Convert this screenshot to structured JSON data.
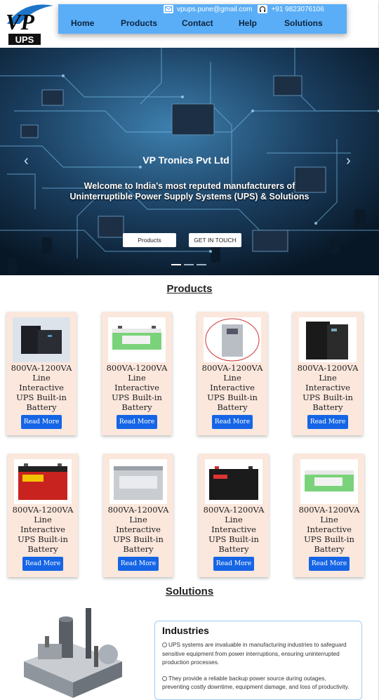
{
  "header": {
    "logo_text": "UPS",
    "email": "vpups.pune@gmail.com",
    "phone": "+91 9823076106",
    "nav": [
      "Home",
      "Products",
      "Contact",
      "Help",
      "Solutions"
    ]
  },
  "hero": {
    "title": "VP Tronics Pvt Ltd",
    "subtitle_line1": "Welcome to India's most reputed manufacturers of",
    "subtitle_line2": "Uninterruptible Power Supply Systems (UPS) & Solutions",
    "btn_products": "Products",
    "btn_contact": "GET IN TOUCH"
  },
  "products": {
    "title": "Products",
    "cards": [
      {
        "l1": "800VA-1200VA",
        "l2": "Line",
        "l3": "Interactive",
        "l4": "UPS Built-in",
        "l5": "Battery",
        "btn": "Read More"
      },
      {
        "l1": "800VA-1200VA",
        "l2": "Line",
        "l3": "Interactive",
        "l4": "UPS Built-in",
        "l5": "Battery",
        "btn": "Read More"
      },
      {
        "l1": "800VA-1200VA",
        "l2": "Line",
        "l3": "Interactive",
        "l4": "UPS Built-in",
        "l5": "Battery",
        "btn": "Read More"
      },
      {
        "l1": "800VA-1200VA",
        "l2": "Line",
        "l3": "Interactive",
        "l4": "UPS Built-in",
        "l5": "Battery",
        "btn": "Read More"
      },
      {
        "l1": "800VA-1200VA",
        "l2": "Line",
        "l3": "Interactive",
        "l4": "UPS Built-in",
        "l5": "Battery",
        "btn": "Read More"
      },
      {
        "l1": "800VA-1200VA",
        "l2": "Line",
        "l3": "Interactive",
        "l4": "UPS Built-in",
        "l5": "Battery",
        "btn": "Read More"
      },
      {
        "l1": "800VA-1200VA",
        "l2": "Line",
        "l3": "Interactive",
        "l4": "UPS Built-in",
        "l5": "Battery",
        "btn": "Read More"
      },
      {
        "l1": "800VA-1200VA",
        "l2": "Line",
        "l3": "Interactive",
        "l4": "UPS Built-in",
        "l5": "Battery",
        "btn": "Read More"
      }
    ]
  },
  "solutions": {
    "title": "Solutions",
    "box_title": "Industries",
    "p1": "UPS systems are invaluable in manufacturing industries to safeguard sensitive equipment from power interruptions, ensuring uninterrupted production processes.",
    "p2": "They provide a reliable backup power source during outages, preventing costly downtime, equipment damage, and loss of productivity."
  },
  "colors": {
    "nav_bg": "#5aaef7",
    "button": "#1565e6",
    "card_bg": "#fbe7dc"
  }
}
